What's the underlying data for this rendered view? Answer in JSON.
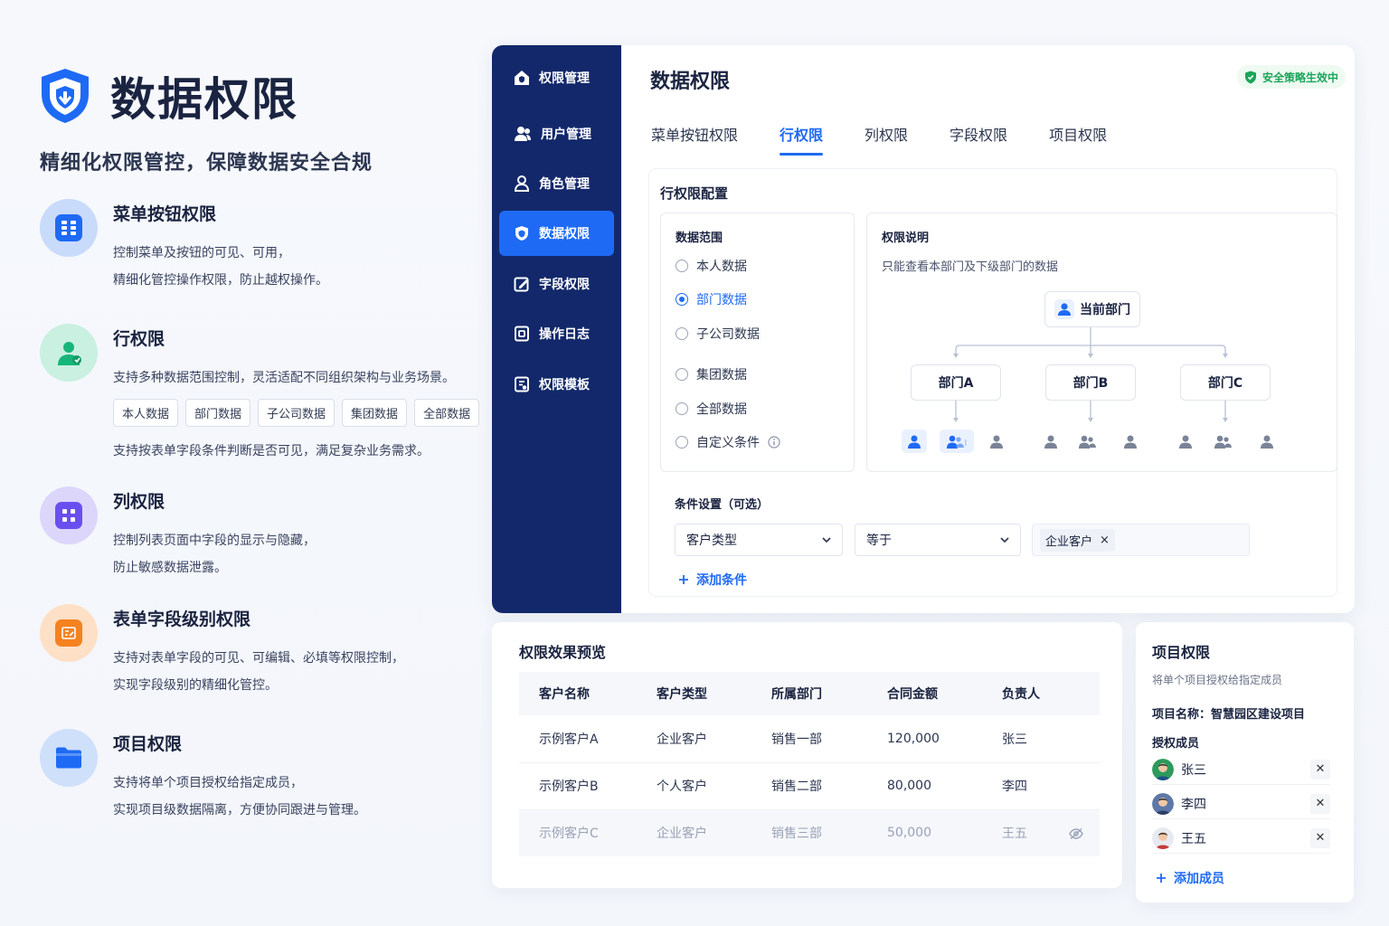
{
  "hero": {
    "title": "数据权限",
    "subtitle": "精细化权限管控，保障数据安全合规"
  },
  "features": {
    "menu": {
      "title": "菜单按钮权限",
      "line1": "控制菜单及按钮的可见、可用，",
      "line2": "精细化管控操作权限，防止越权操作。"
    },
    "row": {
      "title": "行权限",
      "line1": "支持多种数据范围控制，灵活适配不同组织架构与业务场景。",
      "tags": [
        "本人数据",
        "部门数据",
        "子公司数据",
        "集团数据",
        "全部数据"
      ],
      "line2": "支持按表单字段条件判断是否可见，满足复杂业务需求。"
    },
    "column": {
      "title": "列权限",
      "line1": "控制列表页面中字段的显示与隐藏，",
      "line2": "防止敏感数据泄露。"
    },
    "field": {
      "title": "表单字段级别权限",
      "line1": "支持对表单字段的可见、可编辑、必填等权限控制，",
      "line2": "实现字段级别的精细化管控。"
    },
    "project": {
      "title": "项目权限",
      "line1": "支持将单个项目授权给指定成员，",
      "line2": "实现项目级数据隔离，方便协同跟进与管理。"
    }
  },
  "sidebar": {
    "items": [
      {
        "label": "权限管理",
        "icon": "home-shield-icon"
      },
      {
        "label": "用户管理",
        "icon": "users-icon"
      },
      {
        "label": "角色管理",
        "icon": "user-role-icon"
      },
      {
        "label": "数据权限",
        "icon": "shield-icon",
        "active": true
      },
      {
        "label": "字段权限",
        "icon": "field-edit-icon"
      },
      {
        "label": "操作日志",
        "icon": "log-icon"
      },
      {
        "label": "权限模板",
        "icon": "template-icon"
      }
    ]
  },
  "main": {
    "title": "数据权限",
    "security_badge": "安全策略生效中",
    "tabs": [
      "菜单按钮权限",
      "行权限",
      "列权限",
      "字段权限",
      "项目权限"
    ],
    "active_tab": "行权限"
  },
  "config": {
    "title": "行权限配置",
    "scope_label": "数据范围",
    "options": [
      "本人数据",
      "部门数据",
      "子公司数据",
      "集团数据",
      "全部数据",
      "自定义条件"
    ],
    "selected": "部门数据",
    "desc_label": "权限说明",
    "desc_text": "只能查看本部门及下级部门的数据",
    "org": {
      "root": "当前部门",
      "children": [
        "部门A",
        "部门B",
        "部门C"
      ]
    },
    "cond_label": "条件设置（可选）",
    "field_select": "客户类型",
    "operator_select": "等于",
    "value_chip": "企业客户",
    "add_condition": "添加条件"
  },
  "preview": {
    "title": "权限效果预览",
    "columns": [
      "客户名称",
      "客户类型",
      "所属部门",
      "合同金额",
      "负责人"
    ],
    "rows": [
      [
        "示例客户A",
        "企业客户",
        "销售一部",
        "120,000",
        "张三"
      ],
      [
        "示例客户B",
        "个人客户",
        "销售二部",
        "80,000",
        "李四"
      ],
      [
        "示例客户C",
        "企业客户",
        "销售三部",
        "50,000",
        "王五"
      ]
    ]
  },
  "project_card": {
    "title": "项目权限",
    "desc": "将单个项目授权给指定成员",
    "project_name": "项目名称：智慧园区建设项目",
    "members_label": "授权成员",
    "members": [
      "张三",
      "李四",
      "王五"
    ],
    "add_member": "添加成员"
  },
  "colors": {
    "primary": "#1e6af5",
    "sidebar": "#13286a",
    "success": "#1aa55a",
    "menu_icon_bg": "#c9dbfb",
    "row_icon_bg": "#c9f0e1",
    "column_icon_bg": "#dcd6fb",
    "field_icon_bg": "#fde0c6",
    "project_icon_bg": "#cfe0fb"
  }
}
